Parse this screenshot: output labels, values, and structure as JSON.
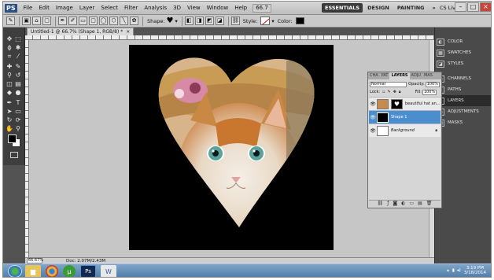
{
  "menubar": {
    "logo": "PS",
    "items": [
      "File",
      "Edit",
      "Image",
      "Layer",
      "Select",
      "Filter",
      "Analysis",
      "3D",
      "View",
      "Window",
      "Help"
    ],
    "zoom": "66.7",
    "workspaces": [
      "ESSENTIALS",
      "DESIGN",
      "PAINTING",
      "»"
    ],
    "cs_live": "CS Live"
  },
  "optbar": {
    "shape_label": "Shape:",
    "style_label": "Style:",
    "color_label": "Color:"
  },
  "document": {
    "tab_title": "Untitled-1 @ 66.7% (Shape 1, RGB/8) *",
    "close": "×"
  },
  "statusbar": {
    "zoom": "66.67%",
    "doc_info": "Doc: 2.07M/2.43M"
  },
  "dock": {
    "items": [
      "COLOR",
      "SWATCHES",
      "STYLES",
      "CHANNELS",
      "PATHS",
      "LAYERS",
      "ADJUSTMENTS",
      "MASKS"
    ]
  },
  "layers_panel": {
    "tabs": [
      "CHA",
      "PAT",
      "LAYERS",
      "ADJU",
      "MAS"
    ],
    "blend_mode": "Normal",
    "opacity_label": "Opacity:",
    "opacity_value": "100%",
    "lock_label": "Lock:",
    "fill_label": "Fill:",
    "fill_value": "100%",
    "layers": [
      {
        "name": "beautiful hat an..."
      },
      {
        "name": "Shape 1"
      },
      {
        "name": "Background"
      }
    ]
  },
  "tray": {
    "time": "3:19 PM",
    "date": "3/18/2014"
  },
  "colors": {
    "selected_layer": "#4a8ed0",
    "essentials_active": "#3a3a3a",
    "canvas": "#000000"
  }
}
